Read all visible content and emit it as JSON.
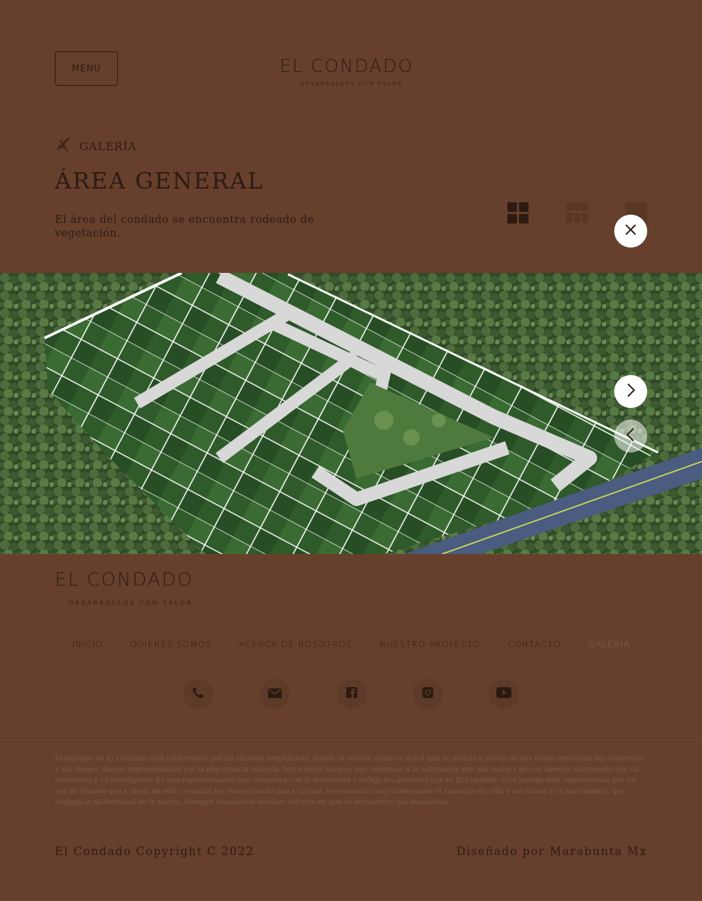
{
  "header": {
    "menu_label": "MENÚ",
    "logo_title": "EL CONDADO",
    "logo_tagline": "DESARROLLOS CON VALOR"
  },
  "breadcrumb": {
    "icon": "leaf-icon",
    "label": "GALERÍA"
  },
  "page": {
    "title": "ÁREA GENERAL",
    "description": "El área del condado se encuentra rodeado de vegetación."
  },
  "view_options": [
    "grid-4-icon",
    "grid-6-icon",
    "single-view-icon"
  ],
  "controls": {
    "close_icon": "close-icon",
    "next_icon": "chevron-right-icon",
    "prev_icon": "chevron-left-icon"
  },
  "gallery_image": {
    "alt_icon": "aerial-site-plan-image"
  },
  "footer": {
    "logo_title": "EL CONDADO",
    "logo_tagline": "DESARROLLOS CON VALOR",
    "nav": [
      {
        "label": "INICIO",
        "active": false
      },
      {
        "label": "QUIENES SOMOS",
        "active": false
      },
      {
        "label": "ACERCA DE NOSOTROS",
        "active": false
      },
      {
        "label": "NUESTRO PROYECTO",
        "active": false
      },
      {
        "label": "CONTACTO",
        "active": false
      },
      {
        "label": "GALERÍA",
        "active": true
      }
    ],
    "social": [
      "phone-icon",
      "mail-icon",
      "facebook-icon",
      "instagram-icon",
      "youtube-icon"
    ],
    "fine_print": "El logotipo de El Condado está conformado por un símbolo simplificado, donde se resalta como un árbol que se mezcla a través de sus líneas orgánicas del desarrollo y sus rasgos. Dando representación por la importancia sobre la tierra entre las que, nos referimos a la naturaleza que nos rodea y que se aprecia claramente con su estructura y su descripción. Es una representación que comunica con la naturaleza y refleja los atributos que es El Condado. Este paisaje está representado por un par de árboles que a modo de sello, resaltan los elementos de una a ciudad. Se encuentra muy interesante el concepto de vida y sus raíces y su movimiento, que designa la modernidad de la marca. Siempre tomando el nombre del sitio en que se encuentran sus elementos.",
    "copyright": "El Condado Copyright C 2022",
    "credits": "Diseñado por Marabunta Mx"
  },
  "colors": {
    "background": "#66402d",
    "text": "#2e1a10",
    "button_bg": "#ffffff"
  }
}
